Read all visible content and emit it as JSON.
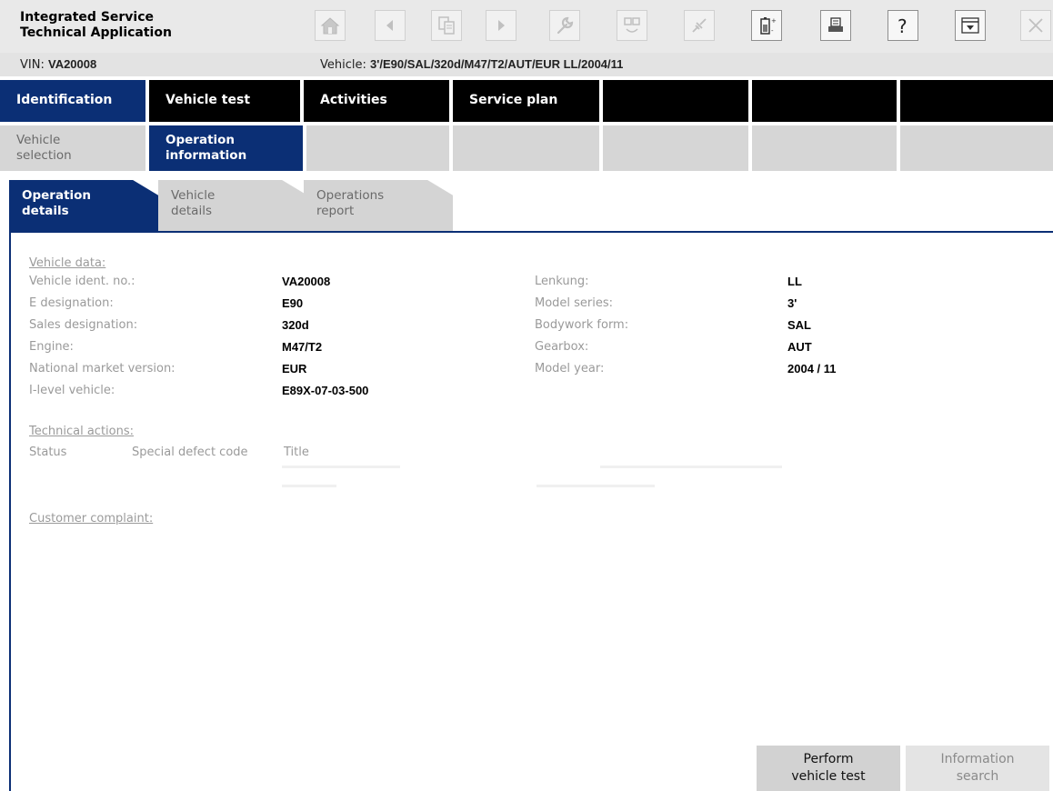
{
  "app": {
    "title": "Integrated Service\nTechnical Application"
  },
  "toolbar": {
    "icons": [
      "home-icon",
      "back-icon",
      "documents-icon",
      "forward-icon",
      "wrench-icon",
      "module-switch-icon",
      "connection-icon",
      "battery-icon",
      "print-icon",
      "help-icon",
      "dropdown-panel-icon",
      "close-icon"
    ]
  },
  "vehicle_bar": {
    "vin_label": "VIN:",
    "vin_value": "VA20008",
    "vehicle_label": "Vehicle:",
    "vehicle_value": "3'/E90/SAL/320d/M47/T2/AUT/EUR LL/2004/11"
  },
  "nav": {
    "tabs": [
      {
        "label": "Identification"
      },
      {
        "label": "Vehicle test"
      },
      {
        "label": "Activities"
      },
      {
        "label": "Service plan"
      }
    ]
  },
  "subnav": {
    "tabs": [
      {
        "label": "Vehicle\nselection"
      },
      {
        "label": "Operation\ninformation"
      }
    ]
  },
  "page_tabs": [
    {
      "label": "Operation\ndetails"
    },
    {
      "label": "Vehicle\ndetails"
    },
    {
      "label": "Operations\nreport"
    }
  ],
  "vehicle_data": {
    "title": "Vehicle data:",
    "left": [
      {
        "label": "Vehicle ident. no.:",
        "value": "VA20008"
      },
      {
        "label": "E designation:",
        "value": "E90"
      },
      {
        "label": "Sales designation:",
        "value": "320d"
      },
      {
        "label": "Engine:",
        "value": "M47/T2"
      },
      {
        "label": "National market version:",
        "value": "EUR"
      },
      {
        "label": "I-level vehicle:",
        "value": "E89X-07-03-500"
      }
    ],
    "right": [
      {
        "label": "Lenkung:",
        "value": "LL"
      },
      {
        "label": "Model series:",
        "value": "3'"
      },
      {
        "label": "Bodywork form:",
        "value": "SAL"
      },
      {
        "label": "Gearbox:",
        "value": "AUT"
      },
      {
        "label": "Model year:",
        "value": "2004 / 11"
      }
    ]
  },
  "technical_actions": {
    "title": "Technical actions:",
    "columns": [
      "Status",
      "Special defect code",
      "Title"
    ]
  },
  "customer_complaint": {
    "title": "Customer complaint:"
  },
  "footer": {
    "perform_test": "Perform\nvehicle test",
    "information_search": "Information\nsearch"
  }
}
